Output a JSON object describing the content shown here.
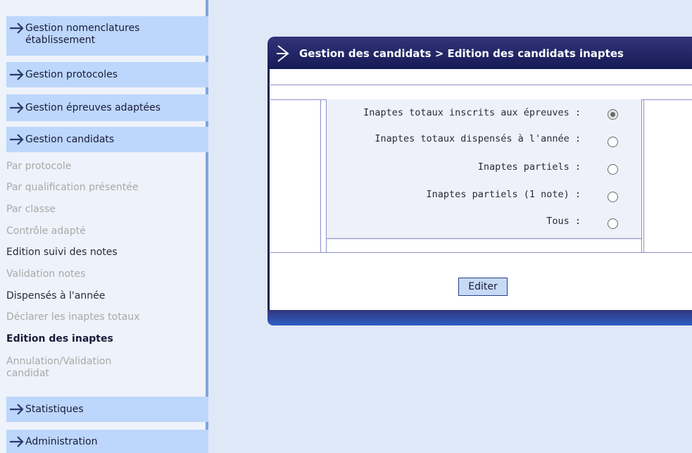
{
  "sidebar": {
    "sections": [
      {
        "label": "Gestion nomenclatures",
        "label2": "établissement"
      },
      {
        "label": "Gestion protocoles"
      },
      {
        "label": "Gestion épreuves adaptées"
      },
      {
        "label": "Gestion candidats"
      },
      {
        "label": "Statistiques"
      },
      {
        "label": "Administration"
      }
    ],
    "items": [
      {
        "label": "Par protocole",
        "state": "disabled"
      },
      {
        "label": "Par qualification présentée",
        "state": "disabled"
      },
      {
        "label": "Par classe",
        "state": "disabled"
      },
      {
        "label": "Contrôle adapté",
        "state": "disabled"
      },
      {
        "label": "Edition suivi des notes",
        "state": "enabled"
      },
      {
        "label": "Validation notes",
        "state": "disabled"
      },
      {
        "label": "Dispensés à l'année",
        "state": "enabled"
      },
      {
        "label": "Déclarer les inaptes totaux",
        "state": "disabled"
      },
      {
        "label": "Edition des inaptes",
        "state": "current"
      },
      {
        "label": "Annulation/Validation",
        "label2": "candidat",
        "state": "disabled"
      }
    ]
  },
  "panel": {
    "title": "Gestion des candidats > Edition des candidats inaptes",
    "options": [
      {
        "label": "Inaptes totaux inscrits aux épreuves :",
        "checked": true
      },
      {
        "label": "Inaptes totaux dispensés à l'année :",
        "checked": false
      },
      {
        "label": "Inaptes partiels :",
        "checked": false
      },
      {
        "label": "Inaptes partiels (1 note) :",
        "checked": false
      },
      {
        "label": "Tous :",
        "checked": false
      }
    ],
    "button_label": "Editer"
  },
  "colors": {
    "header_dark": "#161a55",
    "section_bg": "#bcd7fb",
    "main_bg": "#dfe8f6"
  },
  "icons": {
    "section": "arrow-right-icon"
  }
}
